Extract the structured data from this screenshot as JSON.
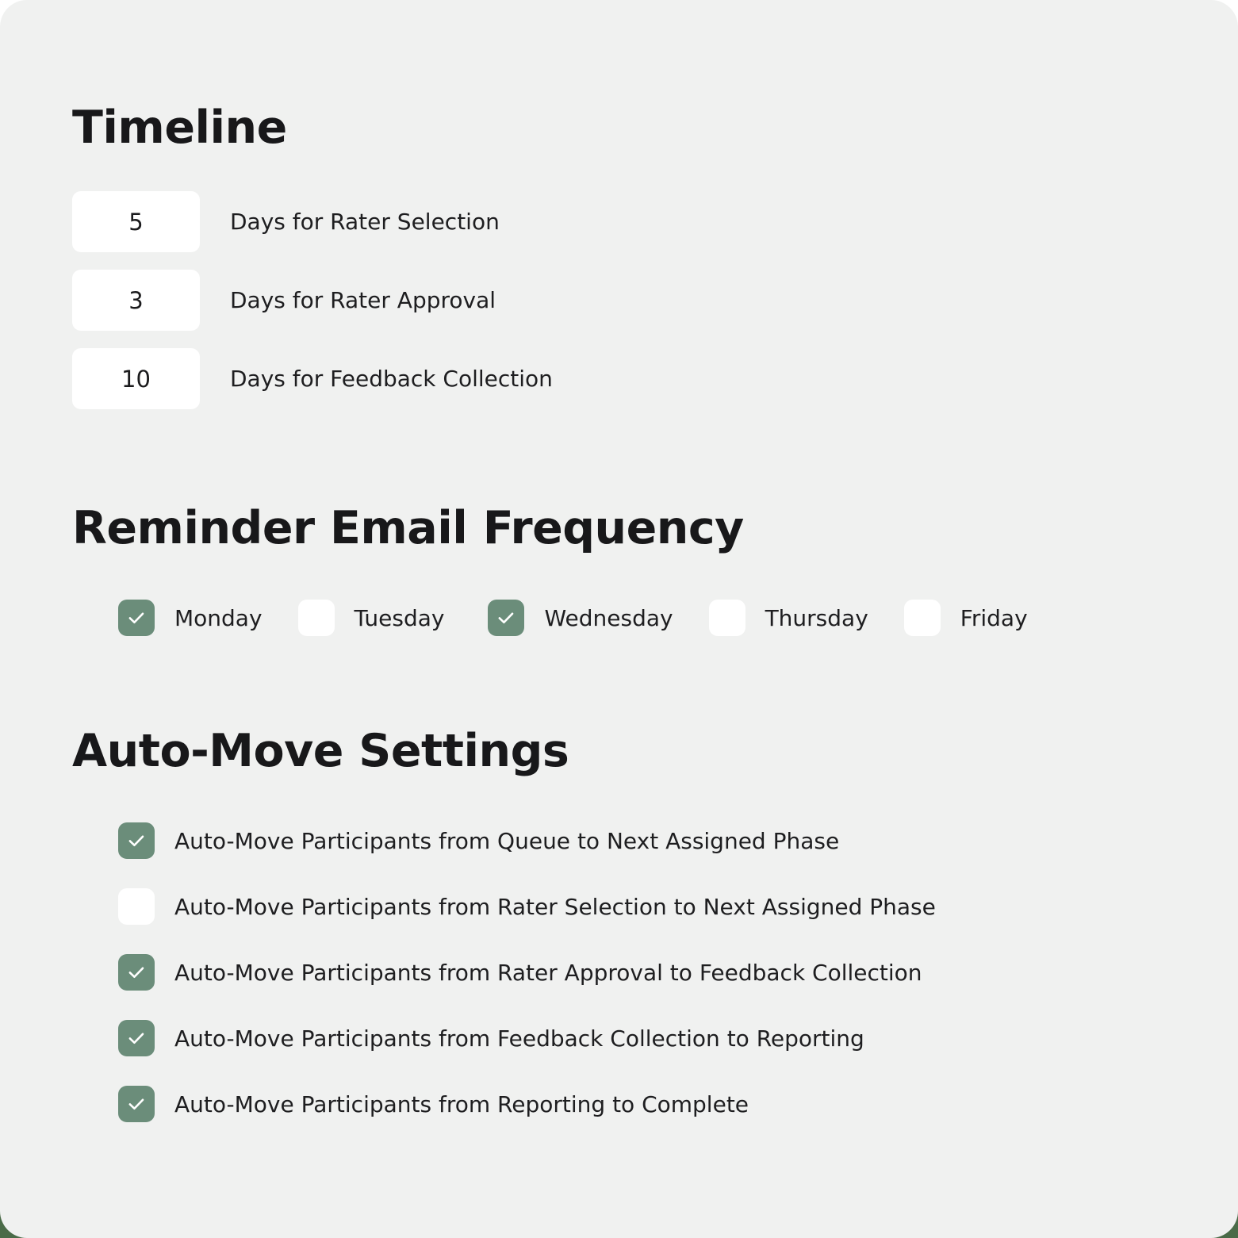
{
  "theme": {
    "card_background": "#f0f1f0",
    "page_background": "#ffffff",
    "backdrop_accent": "#4a6b48",
    "checkbox_checked": "#6b8d7a",
    "checkbox_unchecked": "#ffffff",
    "text_color": "#1e1e20",
    "heading_color": "#18181a",
    "input_background": "#ffffff"
  },
  "timeline": {
    "heading": "Timeline",
    "rows": [
      {
        "value": "5",
        "label": "Days for Rater Selection"
      },
      {
        "value": "3",
        "label": "Days for Rater Approval"
      },
      {
        "value": "10",
        "label": "Days for Feedback Collection"
      }
    ]
  },
  "reminder_email_frequency": {
    "heading": "Reminder Email Frequency",
    "days": [
      {
        "label": "Monday",
        "checked": true
      },
      {
        "label": "Tuesday",
        "checked": false
      },
      {
        "label": "Wednesday",
        "checked": true
      },
      {
        "label": "Thursday",
        "checked": false
      },
      {
        "label": "Friday",
        "checked": false
      }
    ]
  },
  "auto_move_settings": {
    "heading": "Auto-Move Settings",
    "options": [
      {
        "label": "Auto-Move Participants from Queue to Next Assigned Phase",
        "checked": true
      },
      {
        "label": "Auto-Move Participants from Rater Selection to Next Assigned Phase",
        "checked": false
      },
      {
        "label": "Auto-Move Participants from Rater Approval to Feedback Collection",
        "checked": true
      },
      {
        "label": "Auto-Move Participants from Feedback Collection to Reporting",
        "checked": true
      },
      {
        "label": "Auto-Move Participants from Reporting to Complete",
        "checked": true
      }
    ]
  },
  "icons": {
    "checkmark": "check-icon"
  }
}
